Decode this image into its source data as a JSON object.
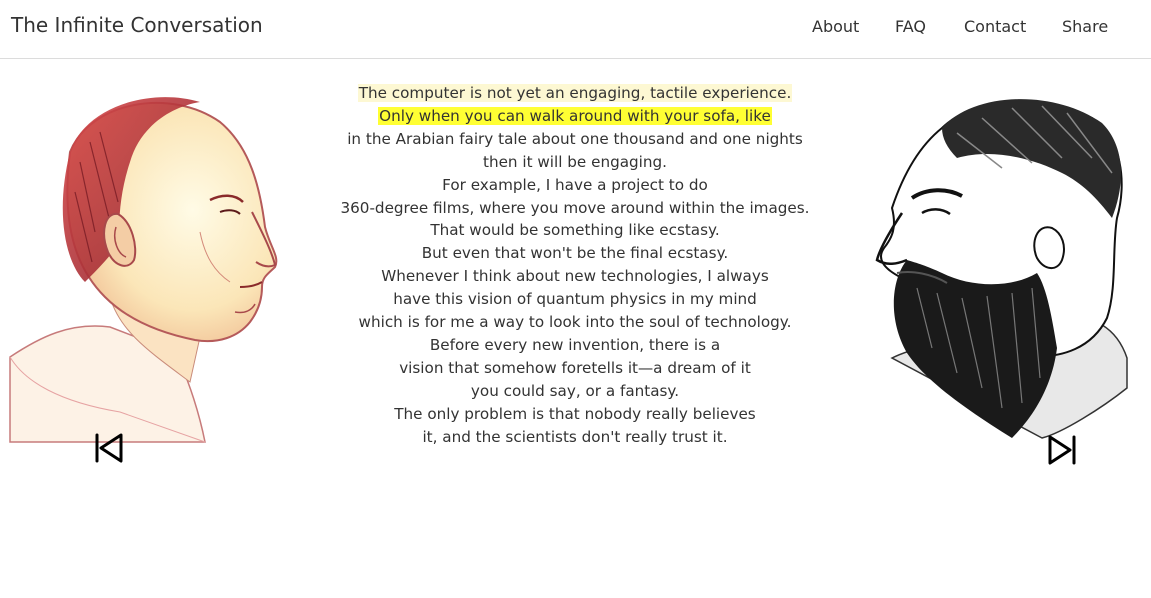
{
  "site": {
    "title": "The Infinite Conversation"
  },
  "nav": {
    "about": "About",
    "faq": "FAQ",
    "contact": "Contact",
    "share": "Share"
  },
  "speakers": {
    "left": {
      "portrait": "bald-man-portrait"
    },
    "right": {
      "portrait": "bearded-man-portrait"
    }
  },
  "transcript": {
    "lines": [
      "The computer is not yet an engaging, tactile experience.",
      "Only when you can walk around with your sofa, like",
      "in the Arabian fairy tale about one thousand and one nights",
      "then it will be engaging.",
      "For example, I have a project to do",
      "360-degree films, where you move around within the images.",
      "That would be something like ecstasy.",
      "But even that won't be the final ecstasy.",
      "Whenever I think about new technologies, I always",
      "have this vision of quantum physics in my mind",
      "which is for me a way to look into the soul of technology.",
      "Before every new invention, there is a",
      "vision that somehow foretells it—a dream of it",
      "you could say, or a fantasy.",
      "The only problem is that nobody really believes",
      "it, and the scientists don't really trust it."
    ]
  },
  "controls": {
    "previous_icon": "skip-previous-icon",
    "next_icon": "skip-next-icon"
  },
  "colors": {
    "highlight_soft": "#fdf8d3",
    "highlight_strong": "#ffff33",
    "text": "#333333",
    "divider": "#dcdcdc"
  }
}
